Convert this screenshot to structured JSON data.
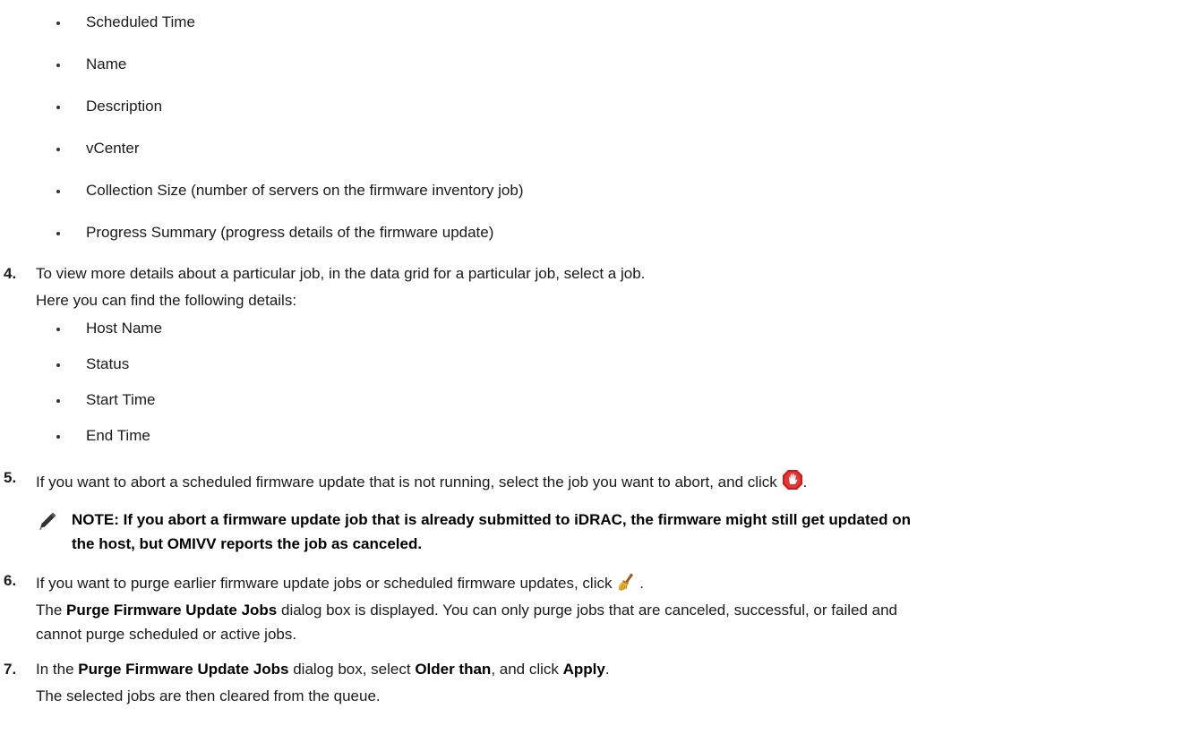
{
  "list1": [
    "Scheduled Time",
    "Name",
    "Description",
    "vCenter",
    "Collection Size (number of servers on the firmware inventory job)",
    "Progress Summary (progress details of the firmware update)"
  ],
  "step4": {
    "num": "4.",
    "text": "To view more details about a particular job, in the data grid for a particular job, select a job.",
    "sub": "Here you can find the following details:"
  },
  "list2": [
    "Host Name",
    "Status",
    "Start Time",
    "End Time"
  ],
  "step5": {
    "num": "5.",
    "text": "If you want to abort a scheduled firmware update that is not running, select the job you want to abort, and click",
    "after": "."
  },
  "note": {
    "line1": "NOTE: If you abort a firmware update job that is already submitted to iDRAC, the firmware might still get updated on",
    "line2": "the host, but OMIVV reports the job as canceled."
  },
  "step6": {
    "num": "6.",
    "text": "If you want to purge earlier firmware update jobs or scheduled firmware updates, click",
    "after": ".",
    "l2a": "The ",
    "l2b": "Purge Firmware Update Jobs",
    "l2c": " dialog box is displayed. You can only purge jobs that are canceled, successful, or failed and",
    "l3": "cannot purge scheduled or active jobs."
  },
  "step7": {
    "num": "7.",
    "a": "In the ",
    "b": "Purge Firmware Update Jobs",
    "c": " dialog box, select ",
    "d": "Older than",
    "e": ", and click ",
    "f": "Apply",
    "g": ".",
    "sub": "The selected jobs are then cleared from the queue."
  }
}
